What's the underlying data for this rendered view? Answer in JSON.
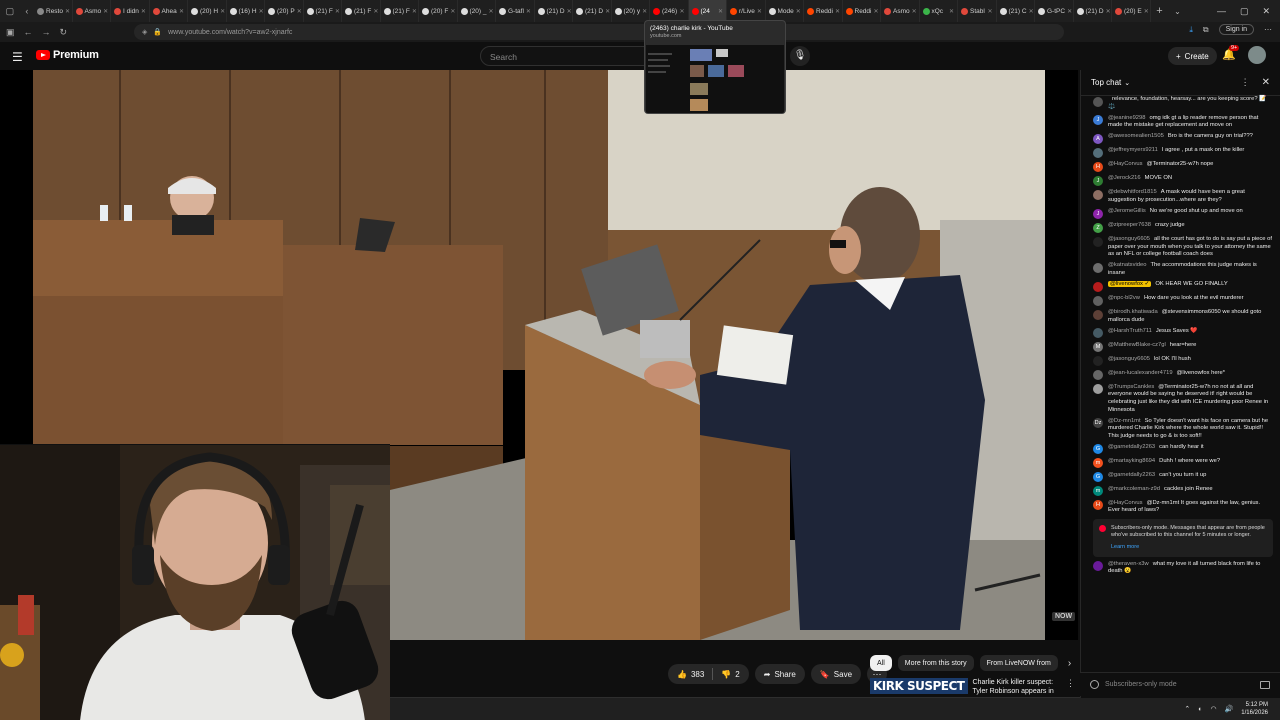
{
  "browser": {
    "tabs": [
      {
        "label": "Resto",
        "color": "#888888"
      },
      {
        "label": "Asmo",
        "color": "#e0483b"
      },
      {
        "label": "I didn",
        "color": "#e0483b"
      },
      {
        "label": "Ahea",
        "color": "#e0483b"
      },
      {
        "label": "(20) H",
        "color": "#dddddd"
      },
      {
        "label": "(16) H",
        "color": "#dddddd"
      },
      {
        "label": "(20) P",
        "color": "#dddddd"
      },
      {
        "label": "(21) F",
        "color": "#dddddd"
      },
      {
        "label": "(21) F",
        "color": "#dddddd"
      },
      {
        "label": "(21) F",
        "color": "#dddddd"
      },
      {
        "label": "(20) F",
        "color": "#dddddd"
      },
      {
        "label": "(20) _",
        "color": "#dddddd"
      },
      {
        "label": "G-tafl",
        "color": "#dddddd"
      },
      {
        "label": "(21) D",
        "color": "#dddddd"
      },
      {
        "label": "(21) D",
        "color": "#dddddd"
      },
      {
        "label": "(20) y",
        "color": "#dddddd"
      },
      {
        "label": "(246)",
        "color": "#ff0000"
      },
      {
        "label": "(24",
        "color": "#ff0000",
        "active": true
      },
      {
        "label": "r/Live",
        "color": "#ff4500"
      },
      {
        "label": "Mode",
        "color": "#dddddd"
      },
      {
        "label": "Reddi",
        "color": "#ff4500"
      },
      {
        "label": "Reddi",
        "color": "#ff4500"
      },
      {
        "label": "Asmo",
        "color": "#e0483b"
      },
      {
        "label": "xQc",
        "color": "#3bb54a"
      },
      {
        "label": "Stabl",
        "color": "#e0483b"
      },
      {
        "label": "(21) C",
        "color": "#dddddd"
      },
      {
        "label": "G-tPC",
        "color": "#dddddd"
      },
      {
        "label": "(21) D",
        "color": "#dddddd"
      },
      {
        "label": "(20) E",
        "color": "#e0483b"
      }
    ],
    "url": "www.youtube.com/watch?v=aw2-xjnarfc",
    "signin_label": "Sign in"
  },
  "tab_preview": {
    "title": "(2463) charlie kirk - YouTube",
    "domain": "youtube.com"
  },
  "youtube": {
    "logo_text": "Premium",
    "search_placeholder": "Search",
    "create_label": "Create",
    "notification_count": "9+"
  },
  "video": {
    "watermark": "NOW",
    "like_count": "383",
    "dislike_count": "2",
    "share_label": "Share",
    "save_label": "Save"
  },
  "chips": [
    "All",
    "More from this story",
    "From LiveNOW from"
  ],
  "recommended": {
    "thumb_text": "KIRK SUSPECT",
    "title": "Charlie Kirk killer suspect: Tyler Robinson appears in court"
  },
  "chat": {
    "header": "Top chat",
    "messages": [
      {
        "user": "",
        "text": "relevance, foundation, hearsay... are you keeping score? 📝 ⚖️",
        "av": "#555555",
        "ch": ""
      },
      {
        "user": "@jeanine9298",
        "text": "omg idk gt a lip reader remove person that made the mistake get replacement and move on",
        "av": "#3a7bd5",
        "ch": "J"
      },
      {
        "user": "@awesomealien1505",
        "text": "Bro is the camera guy on trial???",
        "av": "#7e57c2",
        "ch": "A"
      },
      {
        "user": "@jeffreymyers9211",
        "text": "I agree , put a mask on the killer",
        "av": "#546e7a",
        "ch": ""
      },
      {
        "user": "@HayCorvus",
        "text": "@Terminator25-w7h nope",
        "av": "#e64a19",
        "ch": "H"
      },
      {
        "user": "@Jerock216",
        "text": "MOVE ON",
        "av": "#2e7d32",
        "ch": "J"
      },
      {
        "user": "@debwhitford1815",
        "text": "A mask would have been a great suggestion by prosecution...where are they?",
        "av": "#8d6e63",
        "ch": ""
      },
      {
        "user": "@JeromeGillis",
        "text": "No we're good shut up and move on",
        "av": "#8e24aa",
        "ch": "J"
      },
      {
        "user": "@zipreeper7638",
        "text": "crazy judge",
        "av": "#43a047",
        "ch": "Z"
      },
      {
        "user": "@jasonguy6605",
        "text": "all the court has got to do is say put a piece of paper over your mouth when you talk to your attorney the same as an NFL or college football coach does",
        "av": "#222222",
        "ch": ""
      },
      {
        "user": "@katnatsvideo",
        "text": "The accommodations this judge makes is insane",
        "av": "#6d6d6d",
        "ch": ""
      },
      {
        "user": "@livenowfox ✓",
        "text": "OK HEAR WE GO FINALLY",
        "av": "#b71c1c",
        "ch": "",
        "highlight": true
      },
      {
        "user": "@npc-bl2vw",
        "text": "How dare you look at the evil murderer",
        "av": "#616161",
        "ch": ""
      },
      {
        "user": "@birodh.khatiwada",
        "text": "@stevensimmons6050 we should goto mallorca dude",
        "av": "#5d4037",
        "ch": ""
      },
      {
        "user": "@HarshTruth711",
        "text": "Jesus Saves ❤️",
        "av": "#455a64",
        "ch": ""
      },
      {
        "user": "@MatthewBlake-cz7gl",
        "text": "hear=here",
        "av": "#757575",
        "ch": "M"
      },
      {
        "user": "@jasonguy6605",
        "text": "lol OK I'll hush",
        "av": "#222222",
        "ch": ""
      },
      {
        "user": "@jean-lucalexander4719",
        "text": "@livenowfox here*",
        "av": "#666666",
        "ch": ""
      },
      {
        "user": "@TrumpsCankles",
        "text": "@Terminator25-w7h no not at all and everyone would be saying he deserved it! right would be celebrating just like they did with ICE murdering poor Renee in Minnesota",
        "av": "#9e9e9e",
        "ch": ""
      },
      {
        "user": "@Dz-mn1mt",
        "text": "So Tyler doesn't want his face on camera but he murdered Charlie Kirk where the whole world saw it. Stupid!! This judge needs to go & is too soft!!",
        "av": "#424242",
        "ch": "Dz"
      },
      {
        "user": "@garnetdally2263",
        "text": "can hardly hear it",
        "av": "#1e88e5",
        "ch": "G"
      },
      {
        "user": "@martayking8694",
        "text": "Duhh ! where were we?",
        "av": "#f4511e",
        "ch": "m"
      },
      {
        "user": "@garnetdally2263",
        "text": "can't you turn it up",
        "av": "#1e88e5",
        "ch": "G"
      },
      {
        "user": "@markcoleman-z9d",
        "text": "cackles join Renee",
        "av": "#00897b",
        "ch": "m"
      },
      {
        "user": "@HayCorvus",
        "text": "@Dz-mn1mt It goes against the law, genius. Ever heard of laws?",
        "av": "#e64a19",
        "ch": "H"
      }
    ],
    "notice": {
      "text": "Subscribers-only mode. Messages that appear are from people who've subscribed to this channel for 5 minutes or longer.",
      "link": "Learn more"
    },
    "last_message": {
      "user": "@theraven-x3w",
      "text": "what my love it all turned black from life to death 😮",
      "av": "#6a1b9a",
      "ch": ""
    },
    "input_placeholder": "Subscribers-only mode"
  },
  "taskbar": {
    "time": "5:12 PM",
    "date": "1/16/2026"
  }
}
